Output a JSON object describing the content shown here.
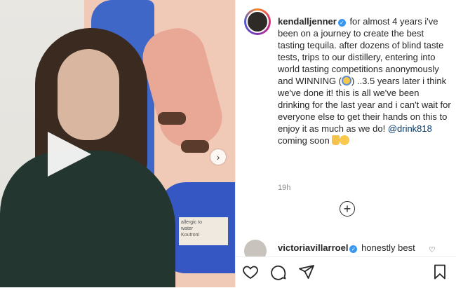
{
  "post": {
    "username": "kendalljenner",
    "caption_part1": "for almost 4 years i've been on a journey to create the best tasting tequila. after dozens of blind taste tests, trips to our distillery, entering into world tasting competitions anonymously and WINNING (",
    "caption_part2": ") ..3.5 years later i think we've done it! this is all we've been drinking for the last year and i can't wait for everyone else to get their hands on this to enjoy it as much as we do! ",
    "mention": "@drink818",
    "caption_part3": " coming soon ",
    "timestamp": "19h",
    "media_label": "allergic to\nwater\nKoutroni"
  },
  "comment": {
    "username": "victoriavillarroel",
    "text": "honestly best"
  },
  "icons": {
    "verified": "verified-badge-icon",
    "play": "play-icon",
    "next": "chevron-right-icon",
    "add": "plus-circle-icon",
    "like": "heart-icon",
    "comment": "comment-bubble-icon",
    "share": "paper-plane-icon",
    "save": "bookmark-icon"
  },
  "colors": {
    "verified": "#3897f0",
    "mention": "#00376b",
    "muted": "#8e8e8e"
  }
}
